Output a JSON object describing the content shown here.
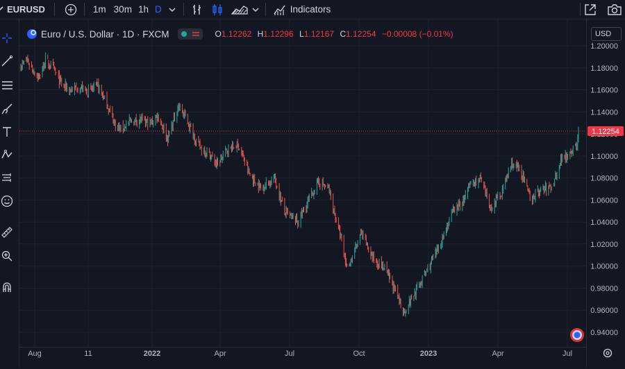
{
  "toolbar": {
    "symbol": "EURUSD",
    "intervals": [
      "1m",
      "30m",
      "1h",
      "D"
    ],
    "indicators_label": "Indicators"
  },
  "legend": {
    "title": "Euro / U.S. Dollar · 1D · FXCM",
    "open_key": "O",
    "open": "1.12262",
    "high_key": "H",
    "high": "1.12296",
    "low_key": "L",
    "low": "1.12167",
    "close_key": "C",
    "close": "1.12254",
    "change": "−0.00008 (−0.01%)"
  },
  "price_scale": {
    "currency": "USD",
    "last_price": "1.12254",
    "ticks": [
      "1.20000",
      "1.18000",
      "1.16000",
      "1.14000",
      "1.12000",
      "1.10000",
      "1.08000",
      "1.06000",
      "1.04000",
      "1.02000",
      "1.00000",
      "0.98000",
      "0.96000",
      "0.94000"
    ]
  },
  "time_axis": {
    "labels": [
      "Aug",
      "11",
      "2022",
      "Apr",
      "Jul",
      "Oct",
      "2023",
      "Apr",
      "Jul"
    ]
  },
  "colors": {
    "background": "#131722",
    "up": "#26a69a",
    "down": "#ef5350",
    "last_price": "#f23645",
    "grid": "#1e222d",
    "accent": "#2962ff"
  },
  "chart_data": {
    "type": "candlestick",
    "interval": "1D",
    "y_min": 0.94,
    "y_max": 1.2,
    "x_range": [
      "2021-07-19",
      "2023-07-14"
    ],
    "last_price": 1.12254,
    "grid": true,
    "path_x": [
      "2021-07-19",
      "2021-07-27",
      "2021-08-04",
      "2021-08-12",
      "2021-08-20",
      "2021-08-31",
      "2021-09-10",
      "2021-09-21",
      "2021-10-04",
      "2021-10-14",
      "2021-10-27",
      "2021-11-08",
      "2021-11-18",
      "2021-11-25",
      "2021-12-08",
      "2021-12-20",
      "2022-01-03",
      "2022-01-13",
      "2022-01-26",
      "2022-02-09",
      "2022-02-21",
      "2022-03-07",
      "2022-03-21",
      "2022-03-31",
      "2022-04-14",
      "2022-04-28",
      "2022-05-12",
      "2022-05-27",
      "2022-06-14",
      "2022-06-27",
      "2022-07-14",
      "2022-08-10",
      "2022-08-23",
      "2022-09-06",
      "2022-09-16",
      "2022-09-28",
      "2022-10-04",
      "2022-10-20",
      "2022-11-04",
      "2022-11-15",
      "2022-11-29",
      "2022-12-15",
      "2023-01-09",
      "2023-02-01",
      "2023-02-13",
      "2023-02-24",
      "2023-03-08",
      "2023-03-22",
      "2023-04-05",
      "2023-04-19",
      "2023-05-01",
      "2023-05-12",
      "2023-05-26",
      "2023-06-09",
      "2023-06-22",
      "2023-07-03",
      "2023-07-12",
      "2023-07-14"
    ],
    "path_y": [
      1.182,
      1.187,
      1.178,
      1.171,
      1.187,
      1.178,
      1.165,
      1.16,
      1.162,
      1.158,
      1.164,
      1.147,
      1.13,
      1.124,
      1.131,
      1.133,
      1.129,
      1.137,
      1.116,
      1.146,
      1.131,
      1.109,
      1.102,
      1.092,
      1.106,
      1.11,
      1.083,
      1.071,
      1.08,
      1.049,
      1.04,
      1.077,
      1.07,
      1.031,
      0.998,
      1.017,
      1.03,
      1.007,
      0.998,
      0.982,
      0.958,
      0.978,
      1.01,
      1.05,
      1.057,
      1.075,
      1.079,
      1.052,
      1.067,
      1.094,
      1.085,
      1.061,
      1.069,
      1.072,
      1.098,
      1.104,
      1.109,
      1.122
    ]
  }
}
